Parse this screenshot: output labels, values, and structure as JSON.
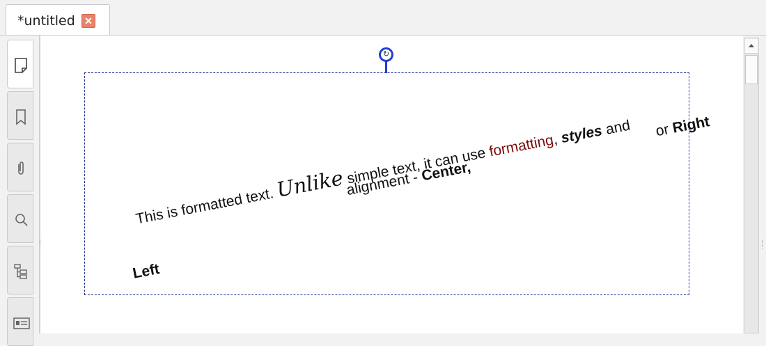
{
  "tab": {
    "title": "*untitled",
    "close_glyph": "✕"
  },
  "sidebar": {
    "items": [
      {
        "icon": "page-icon"
      },
      {
        "icon": "bookmark-icon"
      },
      {
        "icon": "attachment-icon"
      },
      {
        "icon": "search-icon"
      },
      {
        "icon": "tree-icon"
      },
      {
        "icon": "card-icon"
      }
    ]
  },
  "document": {
    "line1": {
      "a": "This is formatted text. ",
      "script": "Unlike",
      "b": "  simple text, it can use ",
      "red": "formatting",
      "comma": ", ",
      "bolditalic": "styles",
      "c": " and"
    },
    "line2": {
      "a": "alignment - ",
      "bold": "Center,"
    },
    "line3": {
      "a": "or ",
      "bold": "Right"
    },
    "left": "Left"
  },
  "colors": {
    "accent": "#1f3fd8",
    "frame": "#1f2f8f",
    "highlight_text": "#7a0c0c",
    "close": "#e8836a"
  }
}
